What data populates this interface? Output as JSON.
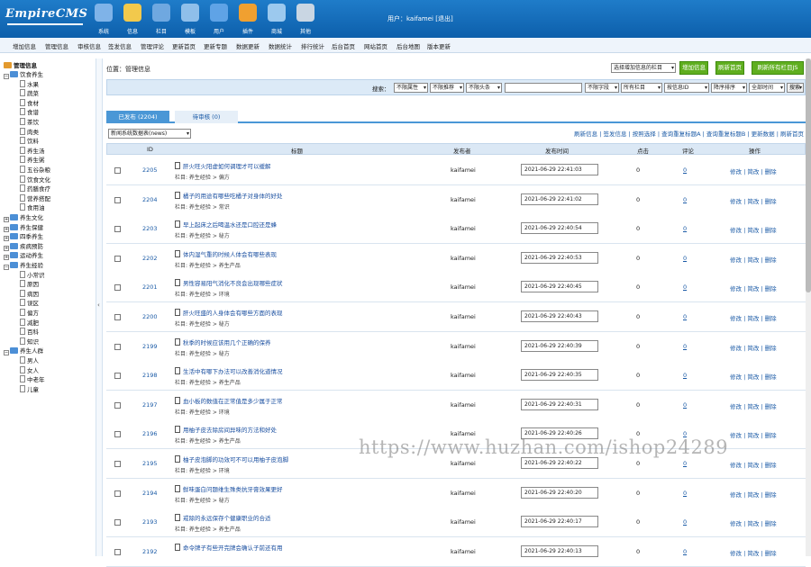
{
  "header": {
    "logo": "EmpireCMS",
    "nav": [
      {
        "label": "系统",
        "icon": "system-icon",
        "color": "#7fb3e8"
      },
      {
        "label": "信息",
        "icon": "pencil-icon",
        "color": "#f2c94c"
      },
      {
        "label": "栏目",
        "icon": "folder-icon",
        "color": "#6fa8e0"
      },
      {
        "label": "模板",
        "icon": "template-icon",
        "color": "#8fbfea"
      },
      {
        "label": "用户",
        "icon": "user-icon",
        "color": "#5fa3e6"
      },
      {
        "label": "插件",
        "icon": "plugin-icon",
        "color": "#f0a030"
      },
      {
        "label": "商城",
        "icon": "shop-icon",
        "color": "#9cc9ee"
      },
      {
        "label": "其他",
        "icon": "gear-icon",
        "color": "#c9d6e3"
      }
    ],
    "user_text": "用户：kaifamei",
    "logout": "[退出]"
  },
  "subnav": [
    "增加信息",
    "管理信息",
    "审核信息",
    "签发信息",
    "管理评论",
    "更新首页",
    "更新专题",
    "数据更新",
    "数据统计",
    "排行统计",
    "后台首页",
    "网站首页",
    "后台地图",
    "版本更新"
  ],
  "sidebar": {
    "title": "管理信息",
    "tree": [
      {
        "t": "饮食养生",
        "lvl": 0,
        "open": true
      },
      {
        "t": "水果",
        "lvl": 1
      },
      {
        "t": "蔬菜",
        "lvl": 1
      },
      {
        "t": "食材",
        "lvl": 1
      },
      {
        "t": "食谱",
        "lvl": 1
      },
      {
        "t": "茶饮",
        "lvl": 1
      },
      {
        "t": "肉类",
        "lvl": 1
      },
      {
        "t": "饮料",
        "lvl": 1
      },
      {
        "t": "养生汤",
        "lvl": 1
      },
      {
        "t": "养生粥",
        "lvl": 1
      },
      {
        "t": "五谷杂粮",
        "lvl": 1
      },
      {
        "t": "饮食文化",
        "lvl": 1
      },
      {
        "t": "药膳食疗",
        "lvl": 1
      },
      {
        "t": "营养搭配",
        "lvl": 1
      },
      {
        "t": "食用油",
        "lvl": 1
      },
      {
        "t": "养生文化",
        "lvl": 0
      },
      {
        "t": "养生保健",
        "lvl": 0
      },
      {
        "t": "四季养生",
        "lvl": 0
      },
      {
        "t": "疾病预防",
        "lvl": 0
      },
      {
        "t": "运动养生",
        "lvl": 0
      },
      {
        "t": "养生经验",
        "lvl": 0,
        "open": true
      },
      {
        "t": "小常识",
        "lvl": 1
      },
      {
        "t": "原因",
        "lvl": 1
      },
      {
        "t": "病因",
        "lvl": 1
      },
      {
        "t": "误区",
        "lvl": 1
      },
      {
        "t": "偏方",
        "lvl": 1
      },
      {
        "t": "减肥",
        "lvl": 1
      },
      {
        "t": "百科",
        "lvl": 1
      },
      {
        "t": "知识",
        "lvl": 1
      },
      {
        "t": "养生人群",
        "lvl": 0,
        "open": true
      },
      {
        "t": "男人",
        "lvl": 1
      },
      {
        "t": "女人",
        "lvl": 1
      },
      {
        "t": "中老年",
        "lvl": 1
      },
      {
        "t": "儿童",
        "lvl": 1
      }
    ]
  },
  "main": {
    "position": "位置：管理信息",
    "column_select": "选择增加信息的栏目",
    "buttons": [
      "增加信息",
      "刷新首页",
      "刷新所有栏目JS"
    ],
    "search": {
      "label": "搜索：",
      "selects": [
        "不限属性",
        "不限推荐",
        "不限头条",
        "",
        "不限字段",
        "所有栏目",
        "按信息ID",
        "降序排序",
        "全部时间"
      ],
      "button": "搜索"
    },
    "tabs": [
      "已发布 (2204)",
      "待审核 (0)"
    ],
    "table_select": "新闻系统数据表(news)",
    "tool_links": "刷新信息 | 签发信息 | 按照选择 | 查询重复标题A | 查询重复标题B | 更新数据 | 刷新首页",
    "columns": {
      "id": "ID",
      "title": "标题",
      "author": "发布者",
      "time": "发布时间",
      "clicks": "点击",
      "comments": "评论",
      "ops": "操作"
    },
    "rows": [
      {
        "id": "2205",
        "title": "肝火旺火阳虚如何调理才可以缓解",
        "col": "栏目: 养生经验 > 偏方",
        "author": "kaifamei",
        "time": "2021-06-29 22:41:03",
        "clicks": "0",
        "comments": "0"
      },
      {
        "id": "2204",
        "title": "橘子的用途有哪些吃橘子对身体的好处",
        "col": "栏目: 养生经验 > 常识",
        "author": "kaifamei",
        "time": "2021-06-29 22:41:02",
        "clicks": "0",
        "comments": "0"
      },
      {
        "id": "2203",
        "title": "早上起床之后喝温水还是口腔还是蜂",
        "col": "栏目: 养生经验 > 秘方",
        "author": "kaifamei",
        "time": "2021-06-29 22:40:54",
        "clicks": "0",
        "comments": "0"
      },
      {
        "id": "2202",
        "title": "体内湿气重的时候人体会有哪些表现",
        "col": "栏目: 养生经验 > 养生产品",
        "author": "kaifamei",
        "time": "2021-06-29 22:40:53",
        "clicks": "0",
        "comments": "0"
      },
      {
        "id": "2201",
        "title": "男性容易阳气消化不良会出现哪些症状",
        "col": "栏目: 养生经验 > 环境",
        "author": "kaifamei",
        "time": "2021-06-29 22:40:45",
        "clicks": "0",
        "comments": "0"
      },
      {
        "id": "2200",
        "title": "肝火旺盛的人身体会有哪些方面的表现",
        "col": "栏目: 养生经验 > 秘方",
        "author": "kaifamei",
        "time": "2021-06-29 22:40:43",
        "clicks": "0",
        "comments": "0"
      },
      {
        "id": "2199",
        "title": "秋季的时候应该用几个正确的保养",
        "col": "栏目: 养生经验 > 秘方",
        "author": "kaifamei",
        "time": "2021-06-29 22:40:39",
        "clicks": "0",
        "comments": "0"
      },
      {
        "id": "2198",
        "title": "生活中有哪下办法可以改善消化道情况",
        "col": "栏目: 养生经验 > 养生产品",
        "author": "kaifamei",
        "time": "2021-06-29 22:40:35",
        "clicks": "0",
        "comments": "0"
      },
      {
        "id": "2197",
        "title": "血小板的数值在正常值是多少属于正常",
        "col": "栏目: 养生经验 > 环境",
        "author": "kaifamei",
        "time": "2021-06-29 22:40:31",
        "clicks": "0",
        "comments": "0"
      },
      {
        "id": "2196",
        "title": "用柚子皮去除房间异味的方法和好处",
        "col": "栏目: 养生经验 > 养生产品",
        "author": "kaifamei",
        "time": "2021-06-29 22:40:26",
        "clicks": "0",
        "comments": "0"
      },
      {
        "id": "2195",
        "title": "柚子皮泡脚的功效可不可以用柚子皮泡脚",
        "col": "栏目: 养生经验 > 环境",
        "author": "kaifamei",
        "time": "2021-06-29 22:40:22",
        "clicks": "0",
        "comments": "0"
      },
      {
        "id": "2194",
        "title": "鲜味蛋白问题维生殊类抗牙膏效果更好",
        "col": "栏目: 养生经验 > 秘方",
        "author": "kaifamei",
        "time": "2021-06-29 22:40:20",
        "clicks": "0",
        "comments": "0"
      },
      {
        "id": "2193",
        "title": "戒除的永远保存个健康职业的合适",
        "col": "栏目: 养生经验 > 养生产品",
        "author": "kaifamei",
        "time": "2021-06-29 22:40:17",
        "clicks": "0",
        "comments": "0"
      },
      {
        "id": "2192",
        "title": "命令牌子有些开完牌会确认子前还有用",
        "col": "",
        "author": "kaifamei",
        "time": "2021-06-29 22:40:13",
        "clicks": "0",
        "comments": "0"
      }
    ],
    "op_links": "修改 | 简改 | 删除"
  },
  "watermark": "https://www.huzhan.com/ishop24289"
}
